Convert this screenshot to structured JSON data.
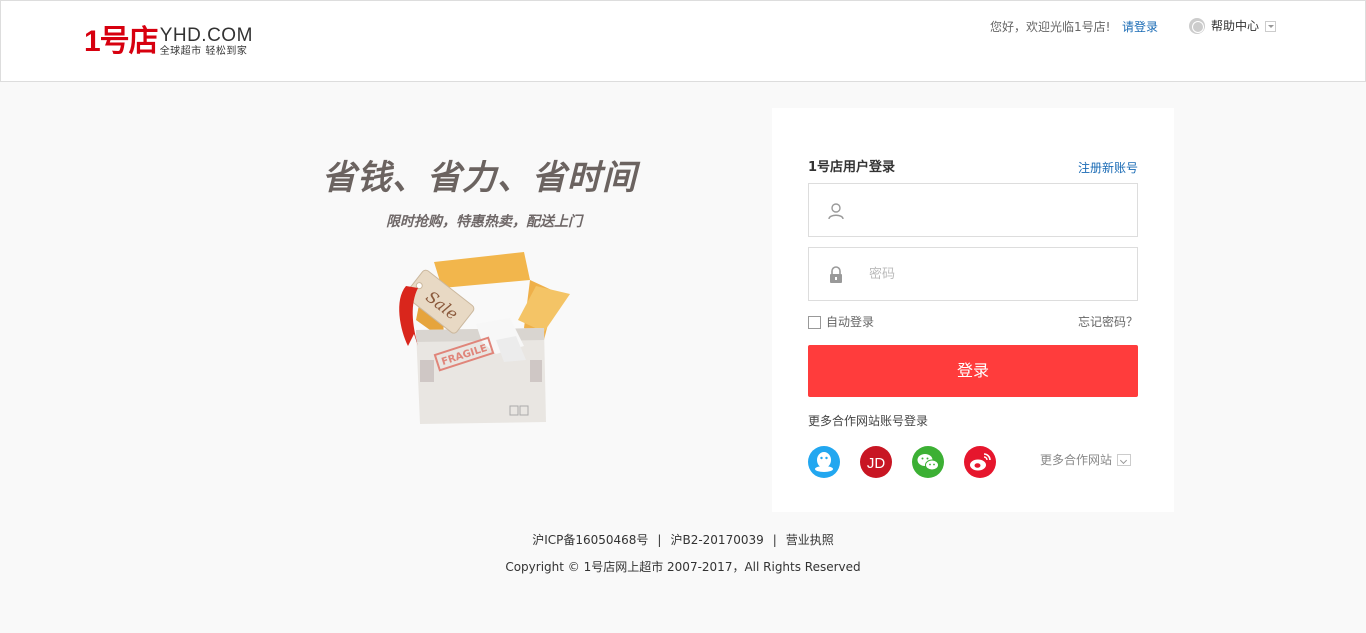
{
  "header": {
    "logo_mark": "1号店",
    "logo_domain": "YHD.COM",
    "logo_slogan": "全球超市 轻松到家",
    "welcome": "您好，欢迎光临1号店!",
    "login_link": "请登录",
    "help": "帮助中心"
  },
  "promo": {
    "title": "省钱、省力、省时间",
    "subtitle": "限时抢购，特惠热卖，配送上门",
    "tag_text": "Sale",
    "stamp_text": "FRAGILE"
  },
  "login": {
    "title": "1号店用户登录",
    "register": "注册新账号",
    "username_placeholder": "",
    "password_placeholder": "密码",
    "auto_login": "自动登录",
    "forgot": "忘记密码？",
    "submit": "登录",
    "partners_title": "更多合作网站账号登录",
    "more_partners": "更多合作网站"
  },
  "footer": {
    "icp": "沪ICP备16050468号",
    "license_b2": "沪B2-20170039",
    "business_license": "营业执照",
    "copyright": "Copyright © 1号店网上超市 2007-2017，All Rights Reserved"
  },
  "colors": {
    "brand_red": "#d7000f",
    "login_button": "#ff3c3c",
    "link_blue": "#1a6bb5",
    "qq": "#22a7f0",
    "jd": "#c81623",
    "wechat": "#3cb034",
    "weibo": "#e6162d"
  },
  "icons": {
    "user": "user-icon",
    "lock": "lock-icon",
    "globe": "globe-icon",
    "qq": "qq-icon",
    "jd": "jd-icon",
    "wechat": "wechat-icon",
    "weibo": "weibo-icon"
  }
}
